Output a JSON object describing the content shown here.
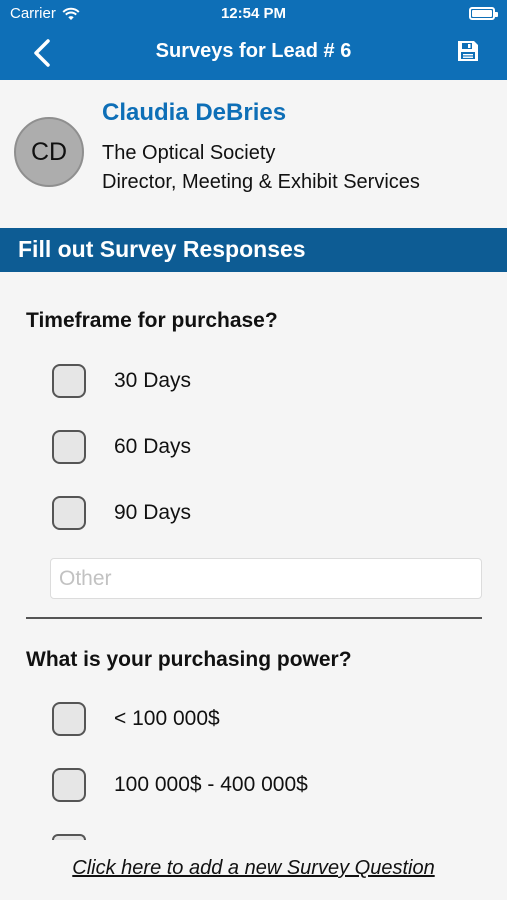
{
  "status_bar": {
    "carrier": "Carrier",
    "time": "12:54 PM"
  },
  "nav": {
    "title": "Surveys for Lead # 6"
  },
  "contact": {
    "initials": "CD",
    "name": "Claudia DeBries",
    "organization": "The Optical Society",
    "role": "Director, Meeting & Exhibit Services"
  },
  "section": {
    "title": "Fill out Survey Responses"
  },
  "questions": [
    {
      "text": "Timeframe for purchase?",
      "options": [
        "30 Days",
        "60 Days",
        "90 Days"
      ],
      "other_placeholder": "Other"
    },
    {
      "text": "What is your purchasing power?",
      "options": [
        "< 100 000$",
        "100 000$ - 400 000$"
      ]
    }
  ],
  "footer": {
    "add_question_link": "Click here to add a new Survey Question"
  },
  "colors": {
    "brand_blue": "#0e6fb7",
    "section_blue": "#0d5c94",
    "background": "#f5f5f5"
  }
}
